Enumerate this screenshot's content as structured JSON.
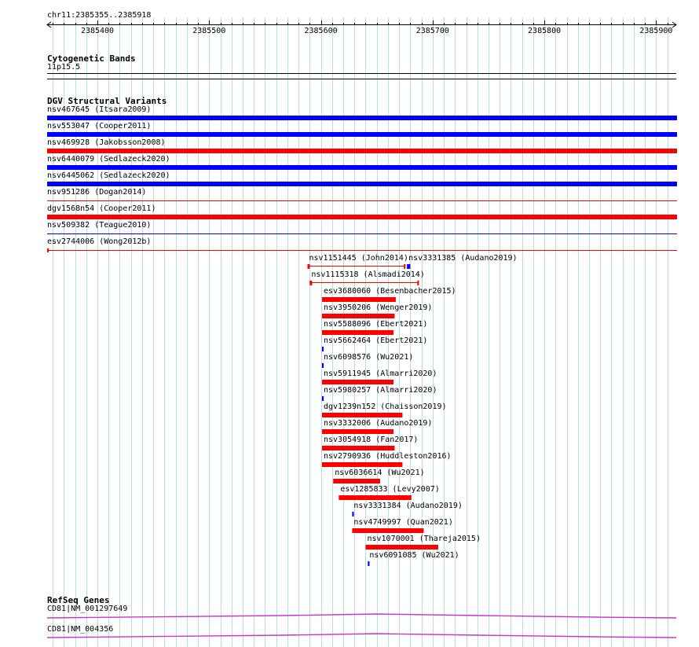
{
  "view": {
    "region": "chr11:2385355..2385918",
    "start": 2385355,
    "end": 2385918
  },
  "ruler": {
    "ticks": [
      {
        "pos": 2385400,
        "label": "2385400"
      },
      {
        "pos": 2385500,
        "label": "2385500"
      },
      {
        "pos": 2385600,
        "label": "2385600"
      },
      {
        "pos": 2385700,
        "label": "2385700"
      },
      {
        "pos": 2385800,
        "label": "2385800"
      },
      {
        "pos": 2385900,
        "label": "2385900"
      }
    ]
  },
  "colors": {
    "grid": "#b8dcea",
    "loss": "#ff0000",
    "gain": "#0000ff",
    "gene": "#cc33cc",
    "track_line": "#000000"
  },
  "cytobands": {
    "title": "Cytogenetic Bands",
    "band": "11p15.5"
  },
  "dgv": {
    "title": "DGV Structural Variants",
    "full_span": [
      {
        "label": "nsv467645 (Itsara2009)",
        "type": "gain",
        "thickness": "thick"
      },
      {
        "label": "nsv553047 (Cooper2011)",
        "type": "gain",
        "thickness": "thick"
      },
      {
        "label": "nsv469928 (Jakobsson2008)",
        "type": "loss",
        "thickness": "thick"
      },
      {
        "label": "nsv6440079 (Sedlazeck2020)",
        "type": "gain",
        "thickness": "thick"
      },
      {
        "label": "nsv6445062 (Sedlazeck2020)",
        "type": "gain",
        "thickness": "thick"
      },
      {
        "label": "nsv951286 (Dogan2014)",
        "type": "loss",
        "thickness": "thin"
      },
      {
        "label": "dgv1568n54 (Cooper2011)",
        "type": "loss",
        "thickness": "thick"
      },
      {
        "label": "nsv509382 (Teague2010)",
        "type": "gain",
        "thickness": "thin"
      },
      {
        "label": "esv2744006 (Wong2012b)",
        "type": "loss",
        "thickness": "thin_marker"
      }
    ],
    "local": [
      {
        "label": "nsv1151445 (John2014)",
        "type": "loss",
        "start": 2385588,
        "end": 2385675,
        "style": "ends"
      },
      {
        "label": "nsv3331385 (Audano2019)",
        "type": "gain",
        "start": 2385677,
        "end": 2385680,
        "style": "thick"
      },
      {
        "label": "nsv1115318 (Alsmadi2014)",
        "type": "loss",
        "start": 2385590,
        "end": 2385687,
        "style": "ends"
      },
      {
        "label": "esv3680060 (Besenbacher2015)",
        "type": "loss",
        "start": 2385601,
        "end": 2385667,
        "style": "thick"
      },
      {
        "label": "nsv3950206 (Wenger2019)",
        "type": "loss",
        "start": 2385601,
        "end": 2385666,
        "style": "thick"
      },
      {
        "label": "nsv5588096 (Ebert2021)",
        "type": "loss",
        "start": 2385601,
        "end": 2385665,
        "style": "thick"
      },
      {
        "label": "nsv5662464 (Ebert2021)",
        "type": "gain",
        "start": 2385601,
        "end": 2385602.5,
        "style": "thick"
      },
      {
        "label": "nsv6098576 (Wu2021)",
        "type": "gain",
        "start": 2385601,
        "end": 2385602.5,
        "style": "thick"
      },
      {
        "label": "nsv5911945 (Almarri2020)",
        "type": "loss",
        "start": 2385601,
        "end": 2385665,
        "style": "thick"
      },
      {
        "label": "nsv5980257 (Almarri2020)",
        "type": "gain",
        "start": 2385601,
        "end": 2385602.5,
        "style": "thick"
      },
      {
        "label": "dgv1239n152 (Chaisson2019)",
        "type": "loss",
        "start": 2385601,
        "end": 2385673,
        "style": "thick"
      },
      {
        "label": "nsv3332006 (Audano2019)",
        "type": "loss",
        "start": 2385601,
        "end": 2385665,
        "style": "thick"
      },
      {
        "label": "nsv3054918 (Fan2017)",
        "type": "loss",
        "start": 2385601,
        "end": 2385666,
        "style": "thick"
      },
      {
        "label": "nsv2790936 (Huddleston2016)",
        "type": "loss",
        "start": 2385601,
        "end": 2385673,
        "style": "thick"
      },
      {
        "label": "nsv6036614 (Wu2021)",
        "type": "loss",
        "start": 2385611,
        "end": 2385653,
        "style": "thick"
      },
      {
        "label": "esv1285833 (Levy2007)",
        "type": "loss",
        "start": 2385616,
        "end": 2385681,
        "style": "thick"
      },
      {
        "label": "nsv3331384 (Audano2019)",
        "type": "gain",
        "start": 2385628,
        "end": 2385629.5,
        "style": "thick"
      },
      {
        "label": "nsv4749997 (Quan2021)",
        "type": "loss",
        "start": 2385628,
        "end": 2385692,
        "style": "thick"
      },
      {
        "label": "nsv1070001 (Thareja2015)",
        "type": "loss",
        "start": 2385640,
        "end": 2385705,
        "style": "thick"
      },
      {
        "label": "nsv6091085 (Wu2021)",
        "type": "gain",
        "start": 2385642,
        "end": 2385643.5,
        "style": "thick"
      }
    ]
  },
  "refseq": {
    "title": "RefSeq Genes",
    "genes": [
      {
        "label": "CD81|NM_001297649"
      },
      {
        "label": "CD81|NM_004356"
      }
    ]
  }
}
